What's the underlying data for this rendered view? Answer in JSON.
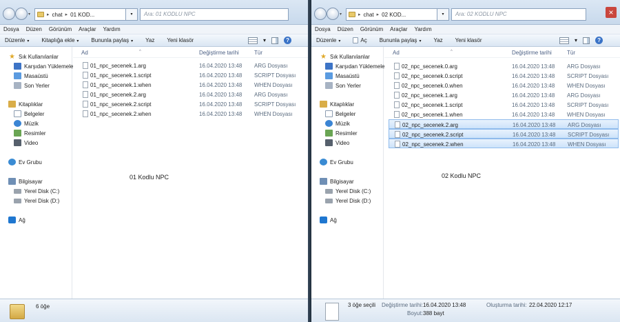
{
  "left": {
    "breadcrumb": [
      "chat",
      "01 KOD..."
    ],
    "search_placeholder": "Ara: 01 KODLU NPC",
    "menu": [
      "Dosya",
      "Düzen",
      "Görünüm",
      "Araçlar",
      "Yardım"
    ],
    "toolbar": {
      "organize": "Düzenle",
      "include": "Kitaplığa ekle",
      "share": "Bununla paylaş",
      "print": "Yaz",
      "new_folder": "Yeni klasör"
    },
    "columns": {
      "name": "Ad",
      "date": "Değiştirme tarihi",
      "type": "Tür"
    },
    "files": [
      {
        "name": "01_npc_secenek.1.arg",
        "date": "16.04.2020 13:48",
        "type": "ARG Dosyası"
      },
      {
        "name": "01_npc_secenek.1.script",
        "date": "16.04.2020 13:48",
        "type": "SCRIPT Dosyası"
      },
      {
        "name": "01_npc_secenek.1.when",
        "date": "16.04.2020 13:48",
        "type": "WHEN Dosyası"
      },
      {
        "name": "01_npc_secenek.2.arg",
        "date": "16.04.2020 13:48",
        "type": "ARG Dosyası"
      },
      {
        "name": "01_npc_secenek.2.script",
        "date": "16.04.2020 13:48",
        "type": "SCRIPT Dosyası"
      },
      {
        "name": "01_npc_secenek.2.when",
        "date": "16.04.2020 13:48",
        "type": "WHEN Dosyası"
      }
    ],
    "overlay_label": "01 Kodlu NPC",
    "status": {
      "count": "6 öğe"
    }
  },
  "right": {
    "breadcrumb": [
      "chat",
      "02 KOD..."
    ],
    "search_placeholder": "Ara: 02 KODLU NPC",
    "menu": [
      "Dosya",
      "Düzen",
      "Görünüm",
      "Araçlar",
      "Yardım"
    ],
    "toolbar": {
      "organize": "Düzenle",
      "open": "Aç",
      "share": "Bununla paylaş",
      "print": "Yaz",
      "new_folder": "Yeni klasör"
    },
    "columns": {
      "name": "Ad",
      "date": "Değiştirme tarihi",
      "type": "Tür"
    },
    "files": [
      {
        "name": "02_npc_secenek.0.arg",
        "date": "16.04.2020 13:48",
        "type": "ARG Dosyası",
        "selected": false
      },
      {
        "name": "02_npc_secenek.0.script",
        "date": "16.04.2020 13:48",
        "type": "SCRIPT Dosyası",
        "selected": false
      },
      {
        "name": "02_npc_secenek.0.when",
        "date": "16.04.2020 13:48",
        "type": "WHEN Dosyası",
        "selected": false
      },
      {
        "name": "02_npc_secenek.1.arg",
        "date": "16.04.2020 13:48",
        "type": "ARG Dosyası",
        "selected": false
      },
      {
        "name": "02_npc_secenek.1.script",
        "date": "16.04.2020 13:48",
        "type": "SCRIPT Dosyası",
        "selected": false
      },
      {
        "name": "02_npc_secenek.1.when",
        "date": "16.04.2020 13:48",
        "type": "WHEN Dosyası",
        "selected": false
      },
      {
        "name": "02_npc_secenek.2.arg",
        "date": "16.04.2020 13:48",
        "type": "ARG Dosyası",
        "selected": true
      },
      {
        "name": "02_npc_secenek.2.script",
        "date": "16.04.2020 13:48",
        "type": "SCRIPT Dosyası",
        "selected": true
      },
      {
        "name": "02_npc_secenek.2.when",
        "date": "16.04.2020 13:48",
        "type": "WHEN Dosyası",
        "selected": true
      }
    ],
    "overlay_label": "02 Kodlu NPC",
    "status": {
      "selected": "3 öğe seçili",
      "modified_label": "Değiştirme tarihi:",
      "modified_value": "16.04.2020 13:48",
      "created_label": "Oluşturma tarihi:",
      "created_value": "22.04.2020 12:17",
      "size_label": "Boyut:",
      "size_value": "388 bayt"
    }
  },
  "nav": {
    "favorites": "Sık Kullanılanlar",
    "downloads": "Karşıdan Yüklemeler",
    "desktop": "Masaüstü",
    "recent": "Son Yerler",
    "libraries": "Kitaplıklar",
    "documents": "Belgeler",
    "music": "Müzik",
    "pictures": "Resimler",
    "videos": "Video",
    "homegroup": "Ev Grubu",
    "computer": "Bilgisayar",
    "disk_c": "Yerel Disk (C:)",
    "disk_d": "Yerel Disk (D:)",
    "network": "Ağ"
  }
}
